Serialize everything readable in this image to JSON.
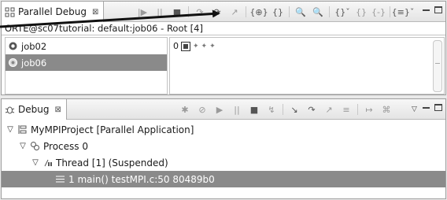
{
  "parallel_debug_view": {
    "tab_title": "Parallel Debug",
    "tab_close": "⊠",
    "toolbar": [
      "|▶",
      "||",
      "■",
      "↷",
      "⟳",
      "↗",
      "{⊕}",
      "{}",
      "🔍",
      "🔍",
      "{}ˇ",
      "{}",
      "{-}",
      "{≡}ˇ"
    ],
    "job_header": "ORTE@sc07tutorial: default:job06 - Root [4]",
    "jobs": [
      {
        "label": "job02"
      },
      {
        "label": "job06"
      }
    ],
    "process_row": {
      "label": "0"
    }
  },
  "debug_view": {
    "tab_title": "Debug",
    "tab_close": "⊠",
    "toolbar": [
      "✱",
      "⊘",
      "▶",
      "||",
      "■",
      "↯",
      "↘",
      "↷",
      "↗",
      "≡",
      "↦",
      "⌘"
    ],
    "tree": [
      {
        "label": "MyMPIProject [Parallel Application]"
      },
      {
        "label": "Process 0"
      },
      {
        "label": "Thread [1] (Suspended)"
      },
      {
        "label": "1 main() testMPI.c:50 80489b0"
      }
    ]
  },
  "colors": {
    "selection": "#8a8a8a",
    "tab_bg": "#ffffff",
    "frame": "#e9e9e9"
  }
}
